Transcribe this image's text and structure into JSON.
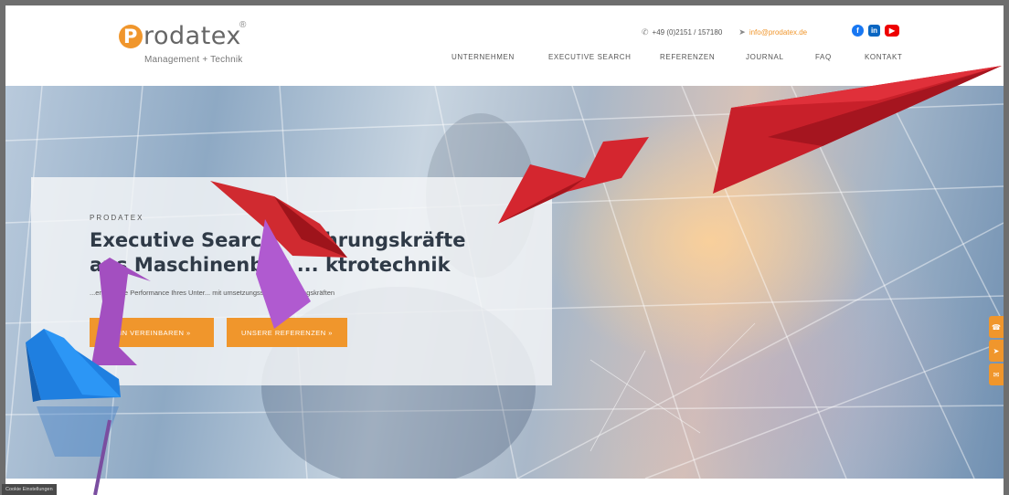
{
  "brand": {
    "name": "rodatex",
    "initial": "P",
    "registered": "®",
    "tagline": "Management + Technik",
    "accent": "#f0962c"
  },
  "contact": {
    "phone_icon": "phone-icon",
    "phone": "+49 (0)2151 / 157180",
    "email_icon": "send-icon",
    "email": "info@prodatex.de"
  },
  "social": {
    "facebook": "f",
    "linkedin": "in",
    "youtube": "▶"
  },
  "nav": {
    "items": [
      "UNTERNEHMEN",
      "EXECUTIVE SEARCH",
      "REFERENZEN",
      "JOURNAL",
      "FAQ",
      "KONTAKT"
    ]
  },
  "hero": {
    "eyebrow": "PRODATEX",
    "headline_line1": "Executive Search ... ührungskräfte",
    "headline_line2": "aus Maschinenbau ... ktrotechnik",
    "subline": "...ern Sie die Performance Ihres Unter... mit umsetzungsstarken Führungskräften",
    "button_primary": "...IN VEREINBAREN »",
    "button_secondary": "UNSERE REFERENZEN »"
  },
  "side_tabs": [
    "☎",
    "➤",
    "✉"
  ],
  "cookie": {
    "label": "Cookie Einstellungen"
  }
}
